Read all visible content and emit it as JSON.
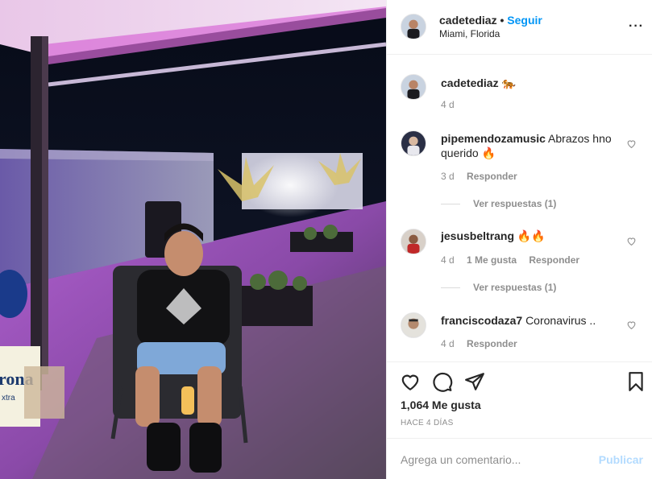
{
  "post": {
    "username": "cadetediaz",
    "separator": "•",
    "follow_label": "Seguir",
    "location": "Miami, Florida",
    "more_label": "···",
    "caption": {
      "author": "cadetediaz",
      "text": "🐅",
      "age": "4 d"
    }
  },
  "comments": [
    {
      "author": "pipemendozamusic",
      "text": "Abrazos hno querido 🔥",
      "age": "3 d",
      "likes": "",
      "reply_label": "Responder",
      "view_replies": "Ver respuestas (1)"
    },
    {
      "author": "jesusbeltrang",
      "text": "🔥🔥",
      "age": "4 d",
      "likes": "1 Me gusta",
      "reply_label": "Responder",
      "view_replies": "Ver respuestas (1)"
    },
    {
      "author": "franciscodaza7",
      "text": "Coronavirus ..",
      "age": "4 d",
      "likes": "",
      "reply_label": "Responder",
      "view_replies": ""
    }
  ],
  "actions": {
    "likes_count": "1,064 Me gusta",
    "date": "HACE 4 DÍAS",
    "icons": [
      "heart-icon",
      "comment-icon",
      "share-icon",
      "bookmark-icon"
    ]
  },
  "add_comment": {
    "placeholder": "Agrega un comentario...",
    "publish_label": "Publicar"
  },
  "photo": {
    "box_brand": "rona",
    "box_sub": "xtra"
  },
  "colors": {
    "link": "#0095f6",
    "publish_disabled": "#b3dbff",
    "muted": "#8e8e8e",
    "text": "#262626"
  }
}
